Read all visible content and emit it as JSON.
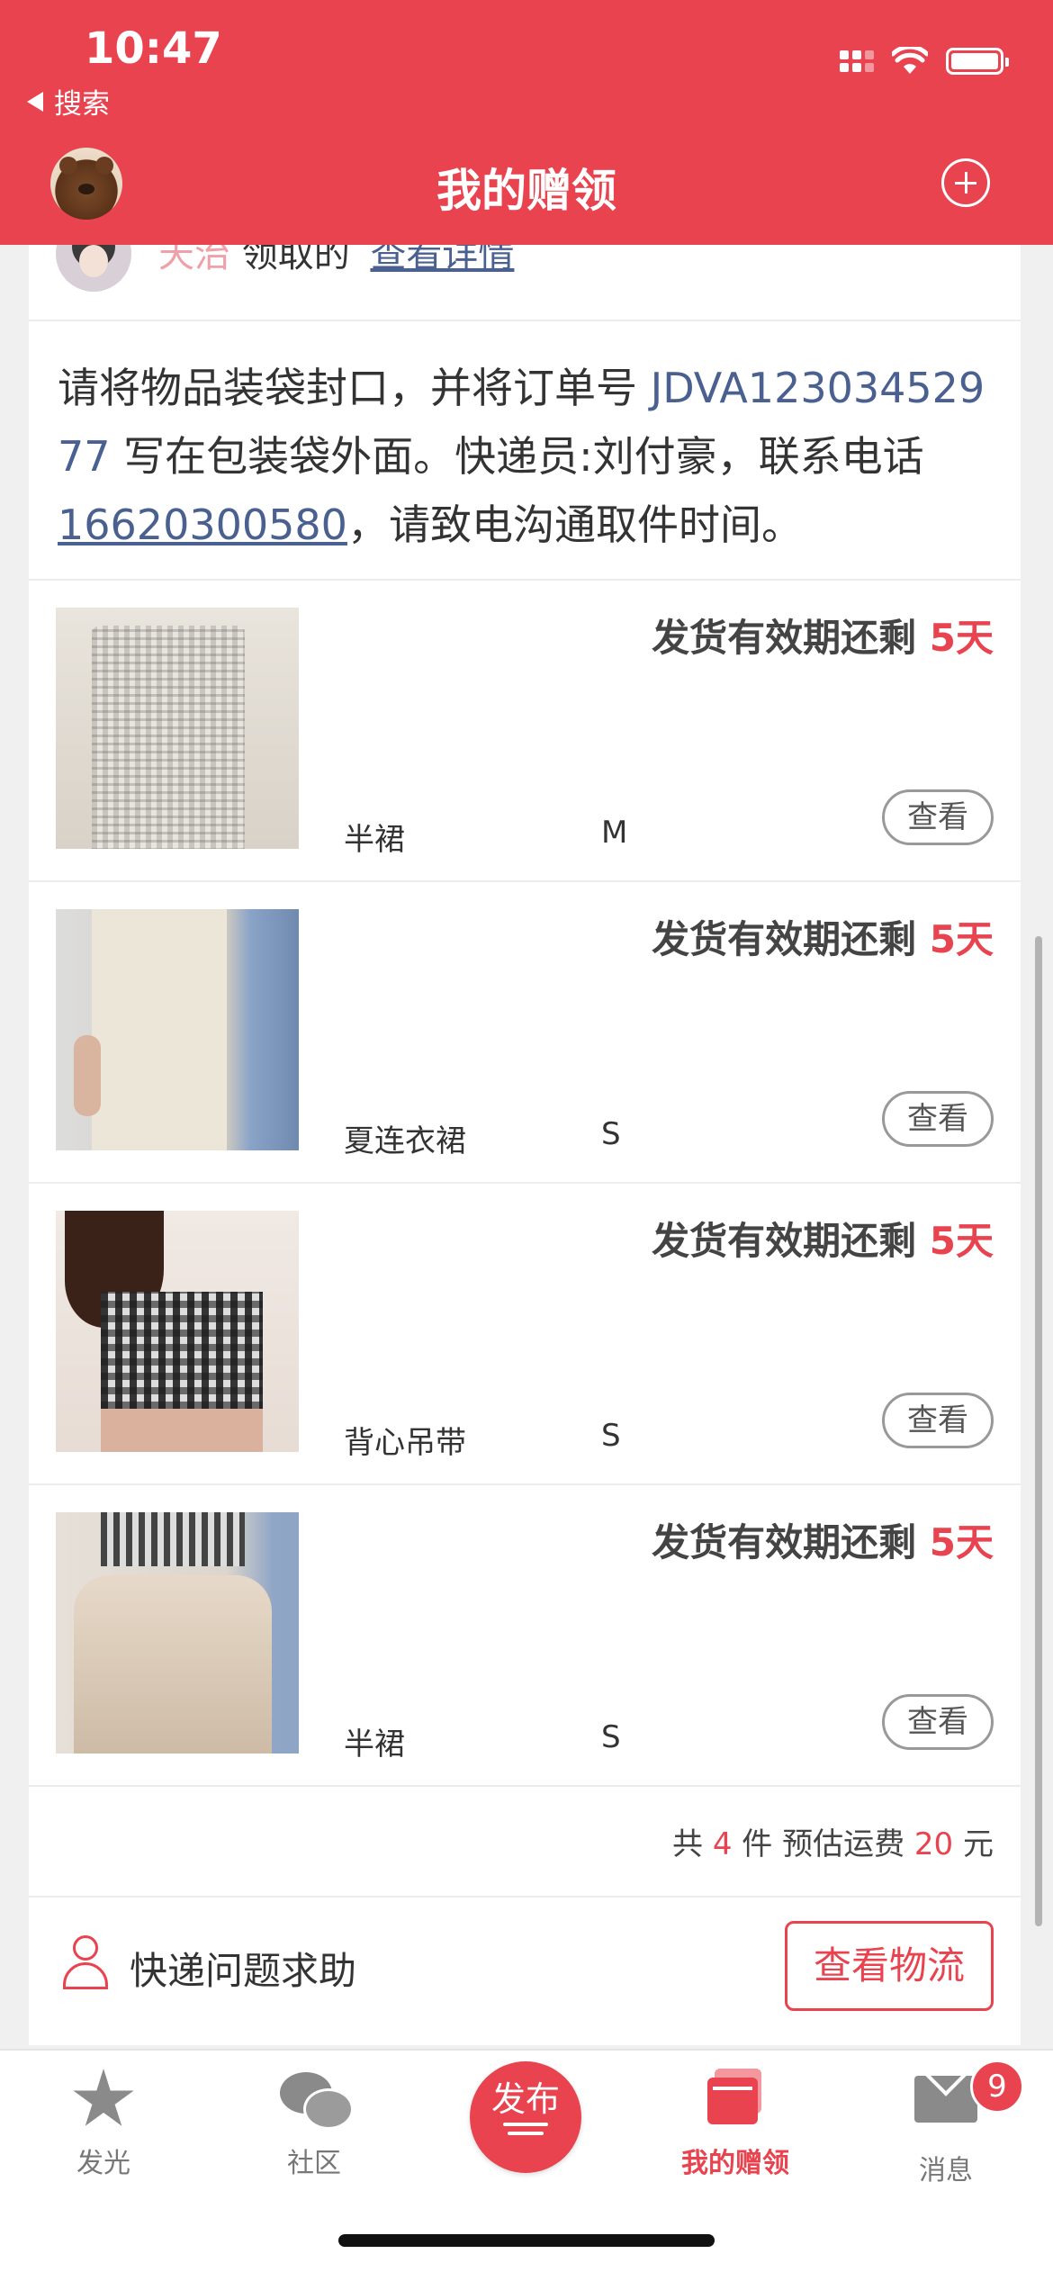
{
  "status_bar": {
    "time": "10:47",
    "back_label": "搜索"
  },
  "header": {
    "title": "我的赠领"
  },
  "claimer": {
    "name": "天治",
    "action": "领取的",
    "link": "查看详情"
  },
  "instructions": {
    "part1": "请将物品装袋封口，并将订单号",
    "order_no": "JDVA12303452977",
    "part2": "写在包装袋外面。快递员:刘付豪，联系电话",
    "phone": "16620300580",
    "part3": "，请致电沟通取件时间。"
  },
  "items": [
    {
      "deadline_prefix": "发货有效期还剩",
      "deadline_days": "5天",
      "name": "半裙",
      "size": "M",
      "view_label": "查看"
    },
    {
      "deadline_prefix": "发货有效期还剩",
      "deadline_days": "5天",
      "name": "夏连衣裙",
      "size": "S",
      "view_label": "查看"
    },
    {
      "deadline_prefix": "发货有效期还剩",
      "deadline_days": "5天",
      "name": "背心吊带",
      "size": "S",
      "view_label": "查看"
    },
    {
      "deadline_prefix": "发货有效期还剩",
      "deadline_days": "5天",
      "name": "半裙",
      "size": "S",
      "view_label": "查看"
    }
  ],
  "summary": {
    "prefix": "共",
    "count": "4",
    "unit": "件 预估运费",
    "fee": "20",
    "currency": "元"
  },
  "help": {
    "label": "快递问题求助",
    "button": "查看物流"
  },
  "tabbar": {
    "tabs": [
      {
        "label": "发光",
        "icon": "star-icon"
      },
      {
        "label": "社区",
        "icon": "chat-bubbles-icon"
      },
      {
        "label": "发布",
        "icon": "publish-icon"
      },
      {
        "label": "我的赠领",
        "icon": "gift-cards-icon",
        "active": true
      },
      {
        "label": "消息",
        "icon": "mail-icon"
      }
    ],
    "message_badge": "9"
  },
  "colors": {
    "accent": "#e8434f",
    "link": "#4a6090"
  }
}
